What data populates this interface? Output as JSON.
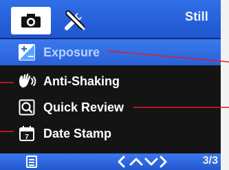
{
  "header": {
    "mode_label": "Still",
    "tabs": [
      {
        "icon": "camera-icon",
        "active": true
      },
      {
        "icon": "tools-icon",
        "active": false
      }
    ]
  },
  "menu": {
    "items": [
      {
        "label": "Exposure",
        "icon": "exposure-icon",
        "selected": true
      },
      {
        "label": "Anti-Shaking",
        "icon": "anti-shaking-hand-icon",
        "selected": false
      },
      {
        "label": "Quick Review",
        "icon": "quick-review-icon",
        "selected": false
      },
      {
        "label": "Date Stamp",
        "icon": "date-stamp-calendar-icon",
        "selected": false
      }
    ]
  },
  "footer": {
    "page_indicator": "3/3",
    "nav_icons": [
      "left-arrow-icon",
      "up-arrow-icon",
      "down-arrow-icon",
      "right-arrow-icon"
    ]
  },
  "colors": {
    "screen_bg": "#141414",
    "accent_blue": "#2f6fe5",
    "selected_row": "#3a79ee",
    "callout_red": "#e6192b",
    "text": "#ffffff"
  }
}
